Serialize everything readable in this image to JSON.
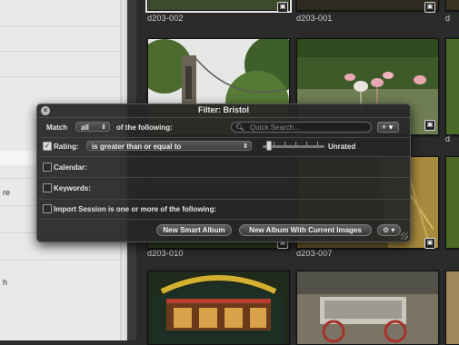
{
  "sidebar": {
    "stubs": [
      "re",
      "h"
    ]
  },
  "browser": {
    "thumbnails": [
      {
        "label": "d203-002",
        "selected": true
      },
      {
        "label": "d203-001",
        "selected": false
      },
      {
        "label": "d",
        "selected": false
      },
      {
        "label": "d203-010",
        "selected": false
      },
      {
        "label": "d203-007",
        "selected": false
      },
      {
        "label": "d",
        "selected": false
      }
    ]
  },
  "hud": {
    "title": "Filter: Bristol",
    "match_label": "Match",
    "match_value": "all",
    "match_suffix": "of the following:",
    "search_placeholder": "Quick Search...",
    "add_button": "+ ▾",
    "rating": {
      "checked": true,
      "label": "Rating:",
      "operator": "is greater than or equal to",
      "value_label": "Unrated"
    },
    "calendar": {
      "checked": false,
      "label": "Calendar:"
    },
    "keywords": {
      "checked": false,
      "label": "Keywords:"
    },
    "import_session": {
      "checked": false,
      "label": "Import Session is one or more of the following:"
    },
    "new_smart_album": "New Smart Album",
    "new_album_current": "New Album With Current Images",
    "gear": "⚙ ▾"
  },
  "colors": {
    "hud_bg": "#262626",
    "browser_bg": "#2b2b2b",
    "sidebar_bg": "#e9e9eb"
  }
}
